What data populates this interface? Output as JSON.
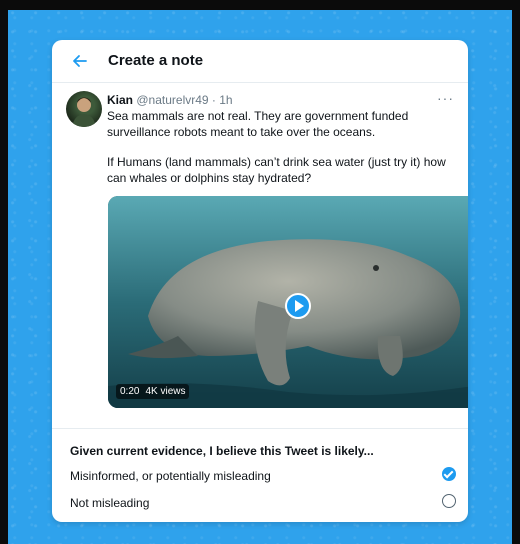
{
  "header": {
    "title": "Create a note"
  },
  "tweet": {
    "author_name": "Kian",
    "author_meta": "@naturelvr49 · 1h",
    "more_label": "···",
    "paragraphs": [
      "Sea mammals are not real. They are government funded surveillance robots meant to take over the oceans.",
      "If Humans (land mammals) can’t drink sea water (just try it) how can whales or dolphins stay hydrated?"
    ],
    "video": {
      "duration": "0:20",
      "views": "4K views"
    }
  },
  "note_form": {
    "question": "Given current evidence, I believe this Tweet is likely...",
    "options": [
      {
        "label": "Misinformed, or potentially misleading",
        "selected": true
      },
      {
        "label": "Not misleading",
        "selected": false
      }
    ]
  },
  "colors": {
    "accent": "#1d9bf0",
    "background": "#2fa2ec"
  },
  "icons": [
    "back-arrow-icon",
    "play-icon",
    "checkmark-icon"
  ]
}
